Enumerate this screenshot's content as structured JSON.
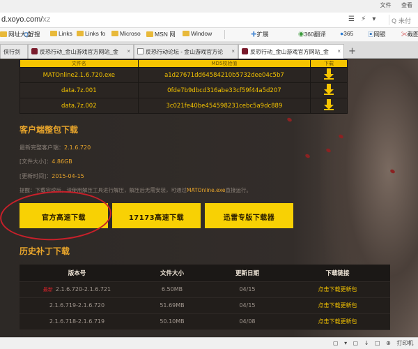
{
  "titlebar": {
    "menu": [
      "文件",
      "查看"
    ]
  },
  "address": {
    "url_prefix": "d.xoyo.com/",
    "url_rest": "xz",
    "tools": [
      "☰",
      "⚡",
      "▾"
    ],
    "search_placeholder": "Q 未付"
  },
  "bookmarks": [
    {
      "label": "网址大全",
      "icon": "folder-icon"
    },
    {
      "label": "好搜",
      "icon": "search-icon"
    },
    {
      "label": "Links",
      "icon": "folder-icon"
    },
    {
      "label": "Links fo",
      "icon": "folder-icon"
    },
    {
      "label": "Microso",
      "icon": "folder-icon"
    },
    {
      "label": "MSN 网",
      "icon": "folder-icon"
    },
    {
      "label": "Window",
      "icon": "folder-icon"
    },
    {
      "label": "扩展",
      "icon": "puzzle-icon"
    },
    {
      "label": "360翻译",
      "icon": "translate-icon"
    },
    {
      "label": "365",
      "icon": "365-icon"
    },
    {
      "label": "网银",
      "icon": "bank-icon"
    },
    {
      "label": "截图",
      "icon": "screenshot-icon"
    }
  ],
  "tabs": [
    {
      "label": "侠行剑",
      "active": false
    },
    {
      "label": "反恐行动_金山游戏官方网站_金",
      "active": false
    },
    {
      "label": "反恐行动论坛 - 金山游戏官方论",
      "active": false
    },
    {
      "label": "反恐行动_金山游戏官方网站_金",
      "active": true
    }
  ],
  "file_table": {
    "headers": [
      "文件名",
      "MD5校验值",
      "下载"
    ],
    "rows": [
      {
        "name": "MATOnline2.1.6.720.exe",
        "md5": "a1d27671dd64584210b5732dee04c5b7"
      },
      {
        "name": "data.7z.001",
        "md5": "0fde7b9dbcd316abe33cf59f44a5d207"
      },
      {
        "name": "data.7z.002",
        "md5": "3c021fe40be454598231cebc5a9dc889"
      }
    ]
  },
  "client": {
    "title": "客户端整包下载",
    "version_label": "最新完整客户端：",
    "version": "2.1.6.720",
    "size_label": "[文件大小]：",
    "size": "4.86GB",
    "date_label": "[更新时间]：",
    "date": "2015-04-15",
    "notice_prefix": "提醒：下载完成后，请使用解压工具进行解压，解压后无需安装，可通过",
    "notice_exe": "MATOnline.exe",
    "notice_suffix": "直接运行。"
  },
  "buttons": {
    "official": "官方高速下载",
    "mirror": "17173高速下载",
    "thunder": "迅雷专版下载器"
  },
  "patch": {
    "title": "历史补丁下载",
    "headers": [
      "版本号",
      "文件大小",
      "更新日期",
      "下载链接"
    ],
    "new_tag": "最新",
    "rows": [
      {
        "version": "2.1.6.720-2.1.6.721",
        "size": "6.50MB",
        "date": "04/15",
        "link": "点击下载更新包"
      },
      {
        "version": "2.1.6.719-2.1.6.720",
        "size": "51.69MB",
        "date": "04/15",
        "link": "点击下载更新包"
      },
      {
        "version": "2.1.6.718-2.1.6.719",
        "size": "50.10MB",
        "date": "04/08",
        "link": "点击下载更新包"
      }
    ]
  },
  "taskbar": {
    "items": [
      "▢",
      "▾",
      "▢",
      "↓",
      "□",
      "⊕",
      "打印机",
      "▭"
    ]
  },
  "colors": {
    "accent_yellow": "#f8d104",
    "heading_orange": "#e8a52b",
    "highlight_red": "#c8202a",
    "page_bg": "#2e2a27"
  }
}
